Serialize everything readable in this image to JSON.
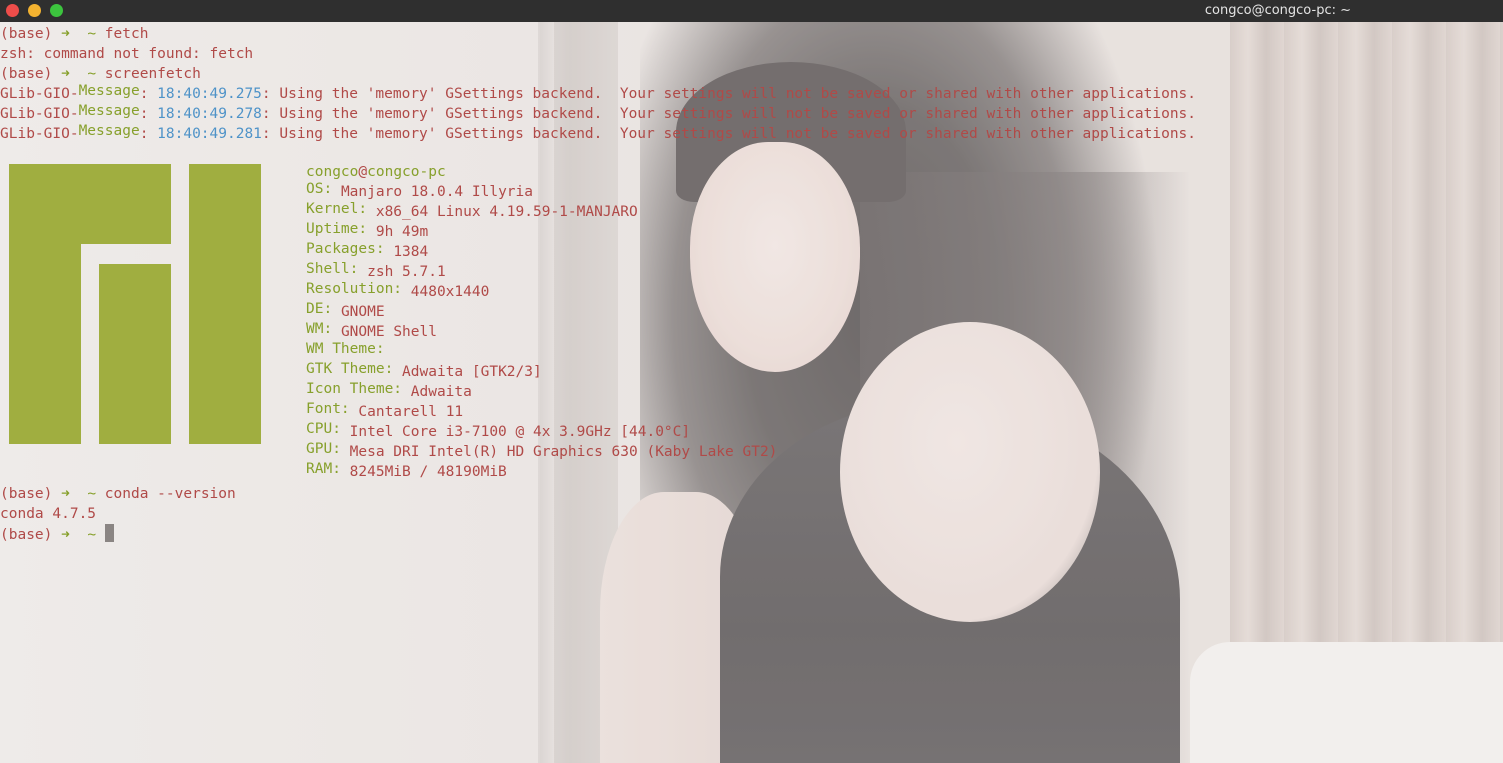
{
  "window": {
    "title": "congco@congco-pc: ~",
    "buttons": [
      "close",
      "minimize",
      "maximize"
    ]
  },
  "colors": {
    "titlebar": "#2f2f2f",
    "text_red": "#b04a48",
    "text_green": "#87a02c",
    "timestamp_blue": "#4f93c8",
    "logo_green": "#a0ae40"
  },
  "terminal": {
    "prompt": {
      "env": "(base)",
      "arrow": "➜",
      "dir": "~"
    },
    "cmd1": "fetch",
    "cmd1_error": "zsh: command not found: fetch",
    "cmd2": "screenfetch",
    "glib_messages": [
      {
        "prefix": "GLib-GIO-",
        "level": "Message",
        "colon": ":",
        "time": "18:40:49.275",
        "text": ": Using the 'memory' GSettings backend.  Your settings will not be saved or shared with other applications."
      },
      {
        "prefix": "GLib-GIO-",
        "level": "Message",
        "colon": ":",
        "time": "18:40:49.278",
        "text": ": Using the 'memory' GSettings backend.  Your settings will not be saved or shared with other applications."
      },
      {
        "prefix": "GLib-GIO-",
        "level": "Message",
        "colon": ":",
        "time": "18:40:49.281",
        "text": ": Using the 'memory' GSettings backend.  Your settings will not be saved or shared with other applications."
      }
    ],
    "cmd3": "conda --version",
    "cmd3_output": "conda 4.7.5"
  },
  "sysinfo": {
    "user": "congco",
    "at": "@",
    "host": "congco-pc",
    "rows": [
      {
        "key": "OS:",
        "value": "Manjaro 18.0.4 Illyria"
      },
      {
        "key": "Kernel:",
        "value": "x86_64 Linux 4.19.59-1-MANJARO"
      },
      {
        "key": "Uptime:",
        "value": "9h 49m"
      },
      {
        "key": "Packages:",
        "value": "1384"
      },
      {
        "key": "Shell:",
        "value": "zsh 5.7.1"
      },
      {
        "key": "Resolution:",
        "value": "4480x1440"
      },
      {
        "key": "DE:",
        "value": "GNOME"
      },
      {
        "key": "WM:",
        "value": "GNOME Shell"
      },
      {
        "key": "WM Theme:",
        "value": ""
      },
      {
        "key": "GTK Theme:",
        "value": "Adwaita [GTK2/3]"
      },
      {
        "key": "Icon Theme:",
        "value": "Adwaita"
      },
      {
        "key": "Font:",
        "value": "Cantarell 11"
      },
      {
        "key": "CPU:",
        "value": "Intel Core i3-7100 @ 4x 3.9GHz [44.0°C]"
      },
      {
        "key": "GPU:",
        "value": "Mesa DRI Intel(R) HD Graphics 630 (Kaby Lake GT2)"
      },
      {
        "key": "RAM:",
        "value": "8245MiB / 48190MiB"
      }
    ]
  }
}
